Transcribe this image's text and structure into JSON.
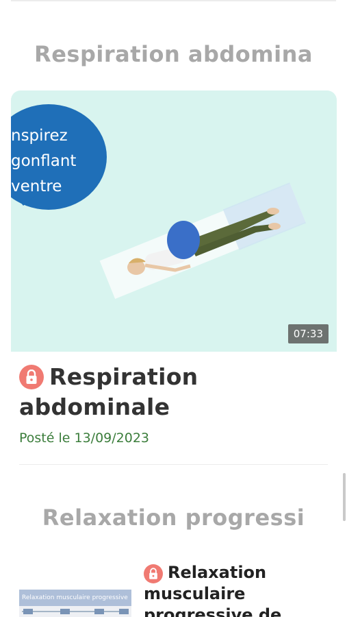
{
  "sections": [
    {
      "heading": "Respiration abdomina",
      "video": {
        "bubble_lines": [
          "nspirez",
          "gonflant",
          " ventre"
        ],
        "duration": "07:33"
      },
      "title": "Respiration abdominale",
      "posted": "Posté le 13/09/2023",
      "locked": true
    },
    {
      "heading": "Relaxation progressi",
      "thumbnail_title": "Relaxation musculaire progressive",
      "title": "Relaxation musculaire progressive de",
      "locked": true
    }
  ],
  "colors": {
    "lock_badge": "#f07a72",
    "posted_text": "#3b7d3b",
    "video_bg": "#d8f4ef",
    "bubble": "#1f6fb8"
  },
  "icons": [
    "lock-icon"
  ]
}
